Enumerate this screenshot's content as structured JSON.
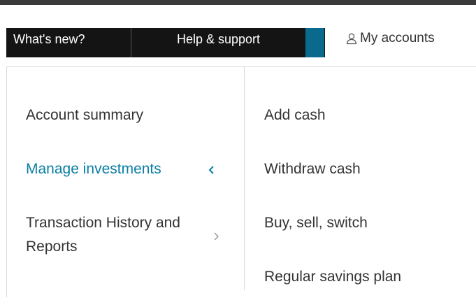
{
  "nav": {
    "whats_new": "What's new?",
    "help_support": "Help & support",
    "my_accounts": "My accounts"
  },
  "menu": {
    "left": [
      {
        "label": "Account summary"
      },
      {
        "label": "Manage investments",
        "active": true
      },
      {
        "label_line1": "Transaction History and",
        "label_line2": "Reports"
      }
    ],
    "right": [
      {
        "label": "Add cash"
      },
      {
        "label": "Withdraw cash"
      },
      {
        "label": "Buy, sell, switch"
      },
      {
        "label": "Regular savings plan"
      }
    ]
  },
  "colors": {
    "active": "#0a7ea4",
    "nav_bg": "#141414",
    "nav_accent": "#0a6a8e",
    "text": "#333333",
    "divider": "#d9d9d9"
  },
  "icons": {
    "account": "person-icon",
    "expanded": "chevron-left-icon",
    "collapsed": "chevron-right-icon"
  }
}
